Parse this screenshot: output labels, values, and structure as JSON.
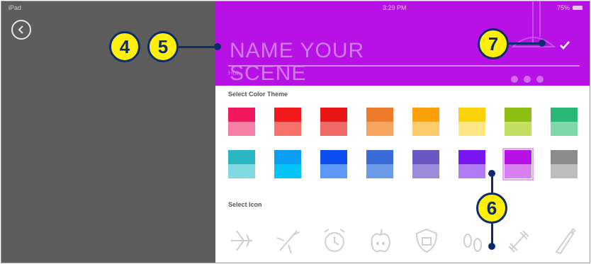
{
  "status_bar": {
    "left": "iPad",
    "time": "3:29 PM",
    "battery": "75%"
  },
  "header": {
    "name_placeholder": "NAME YOUR SCENE",
    "sub_label": "Hob",
    "accent_color": "#b711e6"
  },
  "sections": {
    "color_theme": "Select Color Theme",
    "icon": "Select Icon"
  },
  "color_swatches": [
    {
      "top": "#f2185d",
      "bottom": "#f77ea5"
    },
    {
      "top": "#f21a1a",
      "bottom": "#f7716b"
    },
    {
      "top": "#ea1515",
      "bottom": "#f06a68"
    },
    {
      "top": "#ee7b2c",
      "bottom": "#f5a45f"
    },
    {
      "top": "#fca009",
      "bottom": "#fccc6c"
    },
    {
      "top": "#fbd20a",
      "bottom": "#fde684"
    },
    {
      "top": "#8dbf12",
      "bottom": "#c4de60"
    },
    {
      "top": "#2bb874",
      "bottom": "#7dd9a8"
    },
    {
      "top": "#2ab7c3",
      "bottom": "#7fd9e0"
    },
    {
      "top": "#0c9ef5",
      "bottom": "#05c3f6"
    },
    {
      "top": "#0e4ef0",
      "bottom": "#5d9af7"
    },
    {
      "top": "#3a6bd6",
      "bottom": "#6c9ae6"
    },
    {
      "top": "#6a58c4",
      "bottom": "#9a8ad9"
    },
    {
      "top": "#7a16ef",
      "bottom": "#b07bf5"
    },
    {
      "top": "#b711e6",
      "bottom": "#d97ff2"
    },
    {
      "top": "#8c8c8c",
      "bottom": "#bdbdbd"
    }
  ],
  "selected_swatch": 14,
  "icons": [
    "airplane-landing-icon",
    "airplane-icon",
    "alarm-clock-icon",
    "apple-icon",
    "shield-icon",
    "footprints-icon",
    "dumbbell-icon",
    "baseball-bat-icon"
  ],
  "callouts": {
    "c4": "4",
    "c5": "5",
    "c6": "6",
    "c7": "7"
  }
}
